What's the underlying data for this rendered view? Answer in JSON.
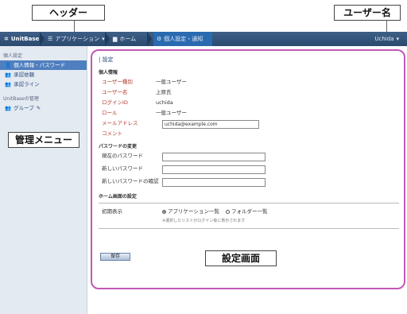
{
  "callouts": {
    "header": "ヘッダー",
    "user": "ユーザー名",
    "menu": "管理メニュー",
    "settings": "設定画面"
  },
  "topbar": {
    "logo": "UnitBase",
    "nav_applications": "アプリケーション",
    "nav_home": "ホーム",
    "nav_personal": "個人設定・通知",
    "user_name": "Uchida"
  },
  "sidebar": {
    "group1": "個人設定",
    "items": [
      {
        "label": "個人情報・パスワード"
      },
      {
        "label": "承認依頼"
      },
      {
        "label": "承認ライン"
      }
    ],
    "group2": "UnitBaseの管理",
    "group_item": "グループ"
  },
  "main": {
    "section_title": "| 設定",
    "personal_header": "個人情報",
    "fields": [
      {
        "label": "ユーザー種別",
        "value": "一般ユーザー"
      },
      {
        "label": "ユーザー名",
        "value": "上原氏"
      },
      {
        "label": "ログインID",
        "value": "uchida"
      },
      {
        "label": "ロール",
        "value": "一般ユーザー"
      }
    ],
    "email_label": "メールアドレス",
    "email_value": "uchida@example.com",
    "comment_label": "コメント",
    "password_header": "パスワードの変更",
    "current_pw_label": "現在のパスワード",
    "new_pw_label": "新しいパスワード",
    "confirm_pw_label": "新しいパスワードの確認",
    "home_header": "ホーム画面の設定",
    "initial_display_label": "初期表示",
    "radio_applications": "アプリケーション一覧",
    "radio_folders": "フォルダー一覧",
    "note": "※選択したリストがログイン後に表示されます",
    "save_label": "保存"
  }
}
